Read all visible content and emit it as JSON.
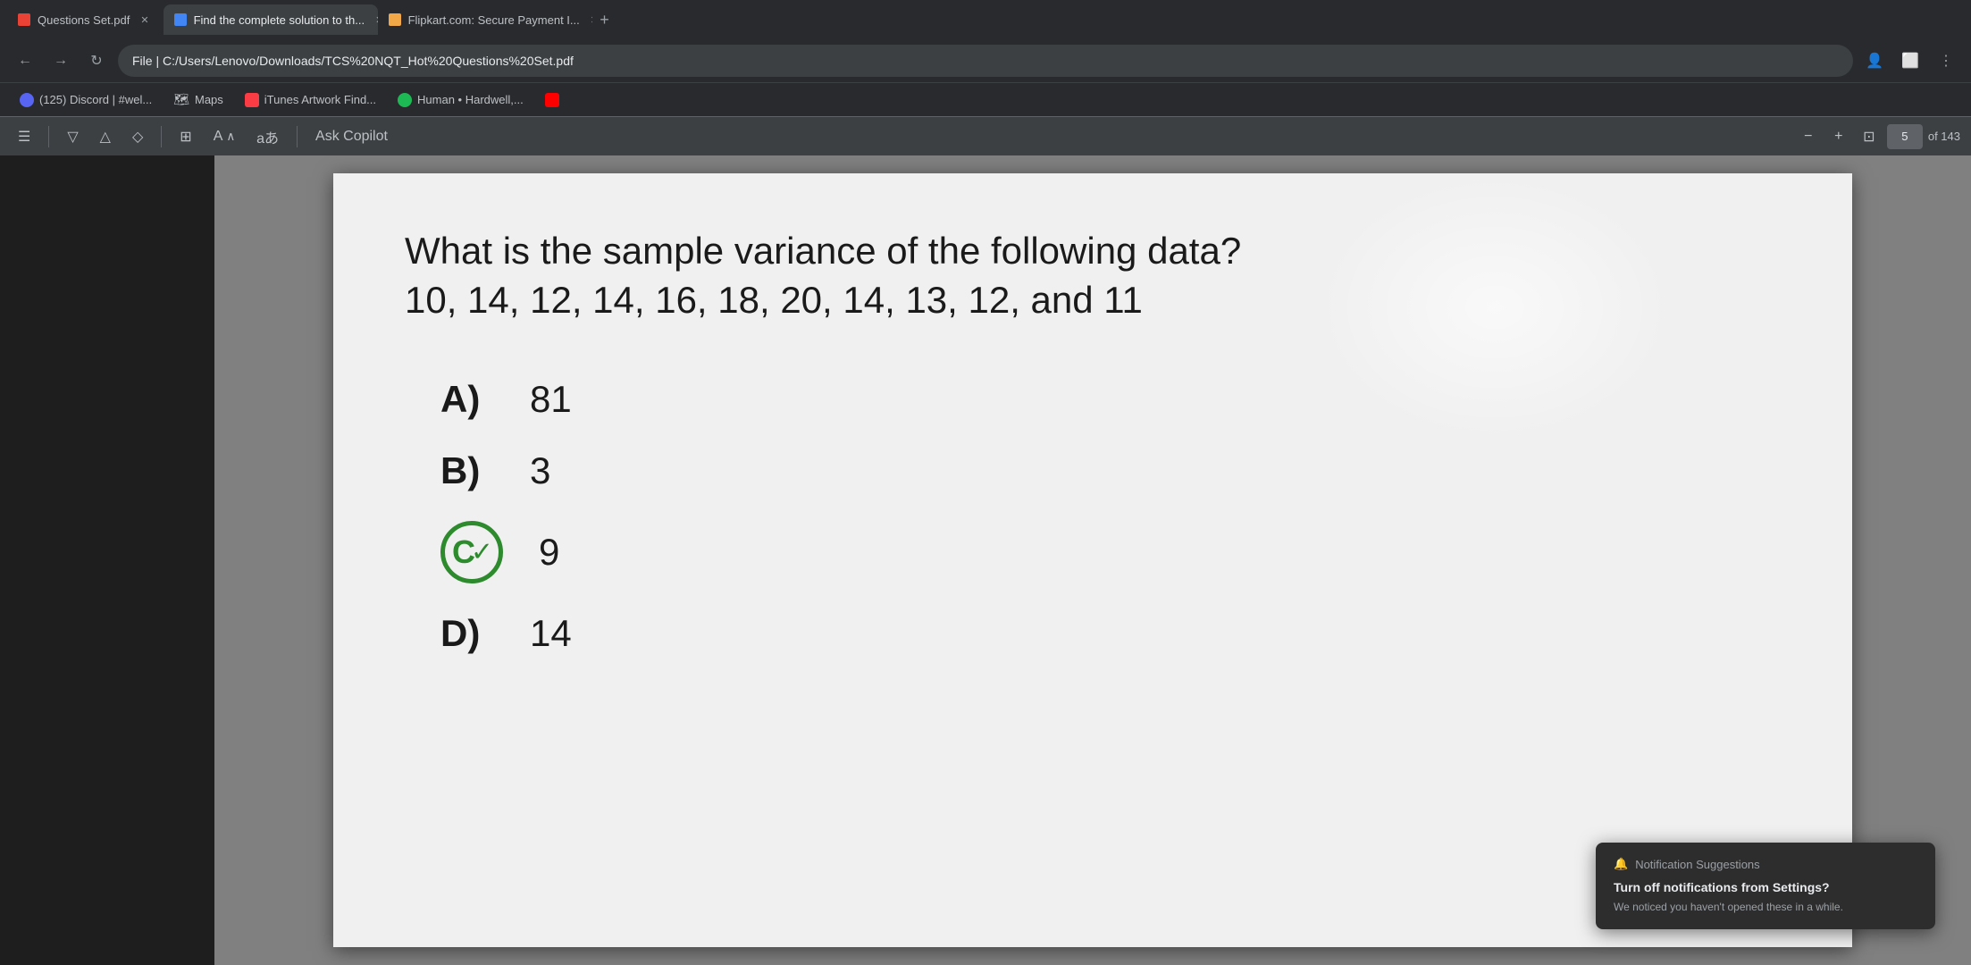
{
  "browser": {
    "tabs": [
      {
        "id": "tab-pdf",
        "label": "Questions Set.pdf",
        "favicon_type": "pdf",
        "active": false,
        "closable": true
      },
      {
        "id": "tab-find-solution",
        "label": "Find the complete solution to th...",
        "favicon_type": "search",
        "active": false,
        "closable": true
      },
      {
        "id": "tab-flipkart",
        "label": "Flipkart.com: Secure Payment I...",
        "favicon_type": "flipkart",
        "active": false,
        "closable": true
      },
      {
        "id": "tab-add",
        "label": "+",
        "is_add": true
      }
    ],
    "address_bar": {
      "url": "C:/Users/Lenovo/Downloads/TCS%20NQT_Hot%20Questions%20Set.pdf",
      "display_text": "File | C:/Users/Lenovo/Downloads/TCS%20NQT_Hot%20Questions%20Set.pdf"
    },
    "bookmarks": [
      {
        "id": "discord",
        "label": "(125) Discord | #wel...",
        "icon_type": "discord"
      },
      {
        "id": "maps",
        "label": "Maps",
        "icon_type": "maps"
      },
      {
        "id": "itunes",
        "label": "iTunes Artwork Find...",
        "icon_type": "itunes"
      },
      {
        "id": "human-hardwell",
        "label": "Human • Hardwell,...",
        "icon_type": "spotify"
      },
      {
        "id": "youtube-red",
        "label": "",
        "icon_type": "youtube"
      }
    ],
    "pdf_toolbar": {
      "tools": [
        "list-icon",
        "filter-down-icon",
        "filter-up-icon",
        "eraser-icon",
        "text-box-icon",
        "text-size-icon",
        "translate-icon"
      ],
      "separator_positions": [
        0,
        4
      ],
      "ask_copilot_label": "Ask Copilot",
      "zoom_minus": "−",
      "zoom_plus": "+",
      "fit_page": "⊡",
      "current_page": "5",
      "total_pages": "of 143"
    }
  },
  "pdf_content": {
    "question": "What is the sample variance of the following data?\n10, 14, 12, 14, 16, 18, 20, 14, 13, 12, and 11",
    "options": [
      {
        "label": "A)",
        "value": "81"
      },
      {
        "label": "B)",
        "value": "3"
      },
      {
        "label": "C)",
        "value": "9",
        "correct": true
      },
      {
        "label": "D)",
        "value": "14"
      }
    ]
  },
  "notification": {
    "header": "Notification Suggestions",
    "title": "Turn off notifications from Settings?",
    "body": "We noticed you haven't opened these in a while."
  }
}
